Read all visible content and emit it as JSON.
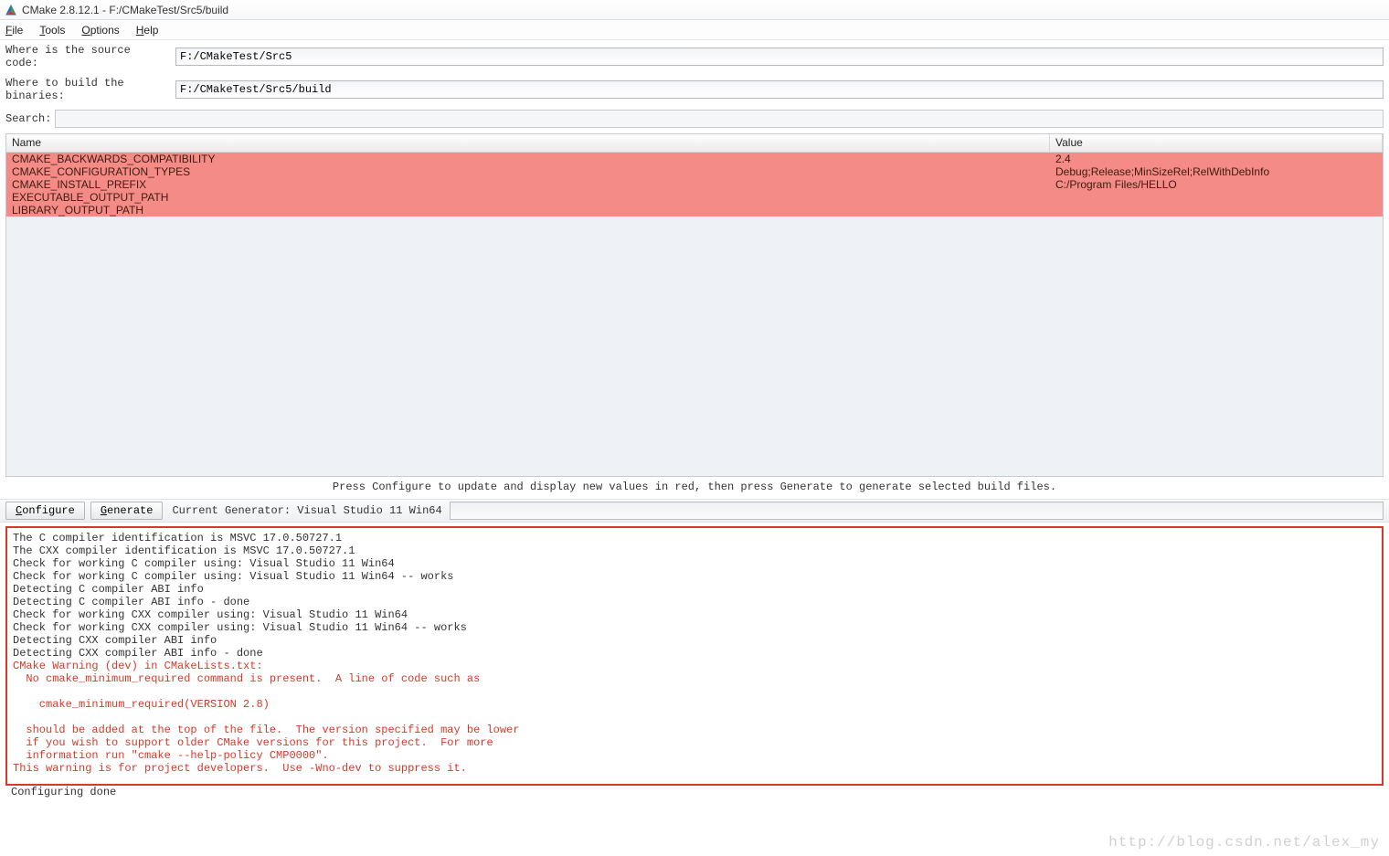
{
  "window": {
    "title": "CMake 2.8.12.1 - F:/CMakeTest/Src5/build"
  },
  "menu": {
    "file": "File",
    "tools": "Tools",
    "options": "Options",
    "help": "Help"
  },
  "labels": {
    "source": "Where is the source code:",
    "build": "Where to build the binaries:",
    "search": "Search:"
  },
  "fields": {
    "source": "F:/CMakeTest/Src5",
    "build": "F:/CMakeTest/Src5/build",
    "search": ""
  },
  "table": {
    "headers": {
      "name": "Name",
      "value": "Value"
    },
    "rows": [
      {
        "name": "CMAKE_BACKWARDS_COMPATIBILITY",
        "value": "2.4"
      },
      {
        "name": "CMAKE_CONFIGURATION_TYPES",
        "value": "Debug;Release;MinSizeRel;RelWithDebInfo"
      },
      {
        "name": "CMAKE_INSTALL_PREFIX",
        "value": "C:/Program Files/HELLO"
      },
      {
        "name": "EXECUTABLE_OUTPUT_PATH",
        "value": ""
      },
      {
        "name": "LIBRARY_OUTPUT_PATH",
        "value": ""
      }
    ]
  },
  "hint": "Press Configure to update and display new values in red, then press Generate to generate selected build files.",
  "buttons": {
    "configure": "Configure",
    "generate": "Generate",
    "generator_label": "Current Generator: Visual Studio 11 Win64"
  },
  "output": [
    {
      "text": "The C compiler identification is MSVC 17.0.50727.1",
      "red": false
    },
    {
      "text": "The CXX compiler identification is MSVC 17.0.50727.1",
      "red": false
    },
    {
      "text": "Check for working C compiler using: Visual Studio 11 Win64",
      "red": false
    },
    {
      "text": "Check for working C compiler using: Visual Studio 11 Win64 -- works",
      "red": false
    },
    {
      "text": "Detecting C compiler ABI info",
      "red": false
    },
    {
      "text": "Detecting C compiler ABI info - done",
      "red": false
    },
    {
      "text": "Check for working CXX compiler using: Visual Studio 11 Win64",
      "red": false
    },
    {
      "text": "Check for working CXX compiler using: Visual Studio 11 Win64 -- works",
      "red": false
    },
    {
      "text": "Detecting CXX compiler ABI info",
      "red": false
    },
    {
      "text": "Detecting CXX compiler ABI info - done",
      "red": false
    },
    {
      "text": "CMake Warning (dev) in CMakeLists.txt:",
      "red": true
    },
    {
      "text": "  No cmake_minimum_required command is present.  A line of code such as",
      "red": true
    },
    {
      "text": "",
      "red": true,
      "blank": true
    },
    {
      "text": "    cmake_minimum_required(VERSION 2.8)",
      "red": true
    },
    {
      "text": "",
      "red": true,
      "blank": true
    },
    {
      "text": "  should be added at the top of the file.  The version specified may be lower",
      "red": true
    },
    {
      "text": "  if you wish to support older CMake versions for this project.  For more",
      "red": true
    },
    {
      "text": "  information run \"cmake --help-policy CMP0000\".",
      "red": true
    },
    {
      "text": "This warning is for project developers.  Use -Wno-dev to suppress it.",
      "red": true
    }
  ],
  "post_output": "Configuring done",
  "watermark": "http://blog.csdn.net/alex_my"
}
